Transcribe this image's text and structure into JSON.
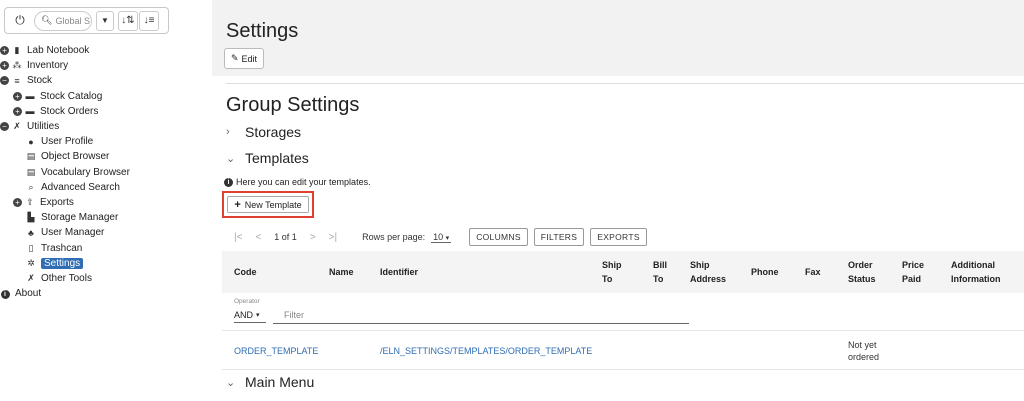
{
  "toolbar": {
    "search_placeholder": "Global S"
  },
  "sidebar": {
    "items": [
      {
        "label": "Lab Notebook",
        "level": 0,
        "toggle": "+",
        "icon": "notebook-icon"
      },
      {
        "label": "Inventory",
        "level": 0,
        "toggle": "+",
        "icon": "inventory-icon"
      },
      {
        "label": "Stock",
        "level": 0,
        "toggle": "−",
        "icon": "stock-icon"
      },
      {
        "label": "Stock Catalog",
        "level": 1,
        "toggle": "+",
        "icon": "folder-icon"
      },
      {
        "label": "Stock Orders",
        "level": 1,
        "toggle": "+",
        "icon": "folder-icon"
      },
      {
        "label": "Utilities",
        "level": 0,
        "toggle": "−",
        "icon": "wrench-icon"
      },
      {
        "label": "User Profile",
        "level": 2,
        "icon": "user-icon"
      },
      {
        "label": "Object Browser",
        "level": 2,
        "icon": "table-icon"
      },
      {
        "label": "Vocabulary Browser",
        "level": 2,
        "icon": "table-icon"
      },
      {
        "label": "Advanced Search",
        "level": 2,
        "icon": "search-icon"
      },
      {
        "label": "Exports",
        "level": 1,
        "toggle": "+",
        "icon": "export-icon"
      },
      {
        "label": "Storage Manager",
        "level": 2,
        "icon": "storage-icon"
      },
      {
        "label": "User Manager",
        "level": 2,
        "icon": "users-icon"
      },
      {
        "label": "Trashcan",
        "level": 2,
        "icon": "trash-icon"
      },
      {
        "label": "Settings",
        "level": 2,
        "icon": "gear-icon",
        "selected": true
      },
      {
        "label": "Other Tools",
        "level": 2,
        "icon": "wrench-icon"
      },
      {
        "label": "About",
        "level": 0,
        "icon": "info-icon"
      }
    ]
  },
  "header": {
    "title": "Settings",
    "edit_label": "Edit"
  },
  "main": {
    "group_title": "Group Settings",
    "storages_label": "Storages",
    "templates_label": "Templates",
    "info_text": "Here you can edit your templates.",
    "new_template_label": "New Template",
    "main_menu_label": "Main Menu"
  },
  "pager": {
    "range": "1 of 1",
    "rows_label": "Rows per page:",
    "rows_value": "10",
    "columns_label": "COLUMNS",
    "filters_label": "FILTERS",
    "exports_label": "EXPORTS"
  },
  "table": {
    "headers": {
      "code": "Code",
      "name": "Name",
      "identifier": "Identifier",
      "ship_to_1": "Ship",
      "ship_to_2": "To",
      "bill_to_1": "Bill",
      "bill_to_2": "To",
      "ship_addr_1": "Ship",
      "ship_addr_2": "Address",
      "phone": "Phone",
      "fax": "Fax",
      "order_status_1": "Order",
      "order_status_2": "Status",
      "price_paid_1": "Price",
      "price_paid_2": "Paid",
      "additional_1": "Additional",
      "additional_2": "Information"
    },
    "filter": {
      "operator_label": "Operator",
      "operator_value": "AND",
      "filter_placeholder": "Filter"
    },
    "rows": [
      {
        "code": "ORDER_TEMPLATE",
        "identifier": "/ELN_SETTINGS/TEMPLATES/ORDER_TEMPLATE",
        "status_1": "Not yet",
        "status_2": "ordered"
      }
    ]
  }
}
